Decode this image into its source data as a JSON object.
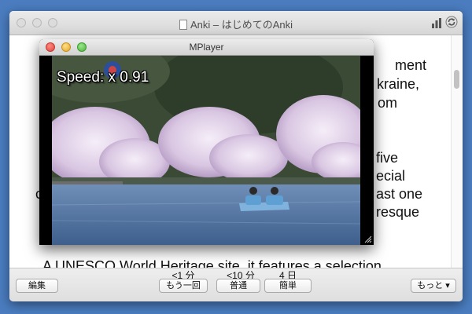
{
  "anki": {
    "title": "Anki – はじめてのAnki",
    "card_text": {
      "line1": "ment",
      "line2": "kraine,",
      "line3": "om",
      "line4": "five",
      "line5": "ecial",
      "line6_left": "c",
      "line6_right": "ast one",
      "line7": "resque",
      "line8": "A UNESCO World Heritage site, it features a selection"
    },
    "bottom": {
      "edit_label": "編集",
      "more_label": "もっと ▾",
      "ease": [
        {
          "interval": "<1 分",
          "label": "もう一回"
        },
        {
          "interval": "<10 分",
          "label": "普通"
        },
        {
          "interval": "4 日",
          "label": "簡単"
        }
      ]
    }
  },
  "mplayer": {
    "title": "MPlayer",
    "osd": "Speed: x   0.91"
  }
}
